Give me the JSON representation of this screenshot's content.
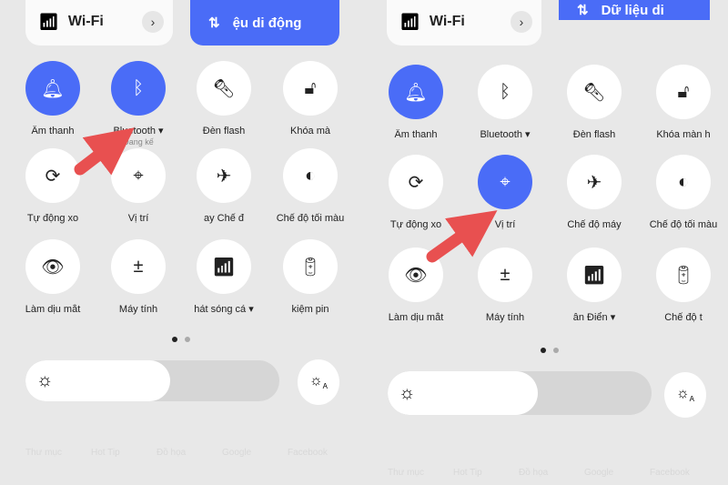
{
  "accent": "#4a6cf7",
  "arrow_color": "#e85050",
  "left": {
    "wifi": "Wi-Fi",
    "mobile_data": "ệu di động",
    "tiles": [
      {
        "label": "Âm thanh",
        "icon": "bell-icon",
        "on": true
      },
      {
        "label": "Bluetooth ▾",
        "sub": "Đang kế",
        "icon": "bluetooth-icon",
        "on": true
      },
      {
        "label": "Đèn flash",
        "icon": "flashlight-icon",
        "on": false
      },
      {
        "label": "Khóa mà",
        "icon": "lock-icon",
        "on": false
      },
      {
        "label": "Tự động xo",
        "icon": "rotate-icon",
        "on": false
      },
      {
        "label": "Vị trí",
        "icon": "location-icon",
        "on": false
      },
      {
        "label": "ay      Chế đ",
        "icon": "airplane-icon",
        "on": false
      },
      {
        "label": "Chế độ tối màu",
        "icon": "dark-mode-icon",
        "on": false
      },
      {
        "label": "Làm dịu mắt",
        "icon": "eye-icon",
        "on": false
      },
      {
        "label": "Máy tính",
        "icon": "calculator-icon",
        "on": false
      },
      {
        "label": "hát sóng cá ▾",
        "icon": "hotspot-icon",
        "on": false
      },
      {
        "label": "kiệm pin",
        "icon": "battery-icon",
        "on": false
      }
    ],
    "brightness": 0.57,
    "page": 1,
    "pages": 2
  },
  "right": {
    "wifi": "Wi-Fi",
    "mobile_data": "Dữ liệu di",
    "tiles": [
      {
        "label": "Âm thanh",
        "icon": "bell-icon",
        "on": true
      },
      {
        "label": "Bluetooth ▾",
        "icon": "bluetooth-icon",
        "on": false
      },
      {
        "label": "Đèn flash",
        "icon": "flashlight-icon",
        "on": false
      },
      {
        "label": "Khóa màn h",
        "icon": "lock-icon",
        "on": false
      },
      {
        "label": "Tự động xo",
        "icon": "rotate-icon",
        "on": false
      },
      {
        "label": "Vị trí",
        "icon": "location-icon",
        "on": true
      },
      {
        "label": "Chế độ máy",
        "icon": "airplane-icon",
        "on": false
      },
      {
        "label": "Chế độ tối màu",
        "icon": "dark-mode-icon",
        "on": false
      },
      {
        "label": "Làm dịu mắt",
        "icon": "eye-icon",
        "on": false
      },
      {
        "label": "Máy tính",
        "icon": "calculator-icon",
        "on": false
      },
      {
        "label": "ân    Điển ▾",
        "icon": "hotspot-icon",
        "on": false
      },
      {
        "label": "Chế độ t",
        "icon": "battery-icon",
        "on": false
      }
    ],
    "brightness": 0.57,
    "page": 1,
    "pages": 2
  },
  "background_apps": [
    "Thư mục",
    "Hot Tip",
    "Đồ họa",
    "Google",
    "Facebook"
  ]
}
